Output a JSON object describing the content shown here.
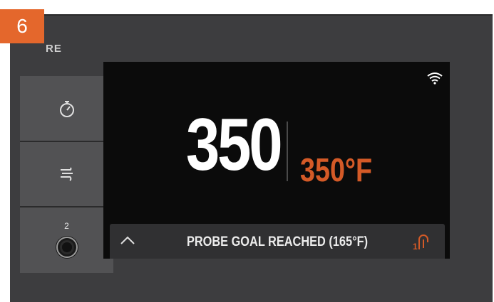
{
  "step_badge": "6",
  "brand_fragment": "RE",
  "side_panel": {
    "timer": {
      "icon": "stopwatch-icon"
    },
    "smoke": {
      "icon": "smoke-icon"
    },
    "probe": {
      "icon": "probe-knob-icon",
      "number": "2"
    }
  },
  "screen": {
    "wifi_icon": "wifi-icon",
    "actual_temp": "350",
    "set_temp": "350°F",
    "status": {
      "chevron_icon": "chevron-up-icon",
      "message": "PROBE GOAL REACHED (165°F)",
      "probe_icon": "probe-1-icon"
    }
  },
  "colors": {
    "accent": "#e4672c",
    "set_temp": "#d45a27",
    "screen_bg": "#0b0b0b",
    "panel_bg": "#525254",
    "device_bg": "#3d3d3f"
  }
}
